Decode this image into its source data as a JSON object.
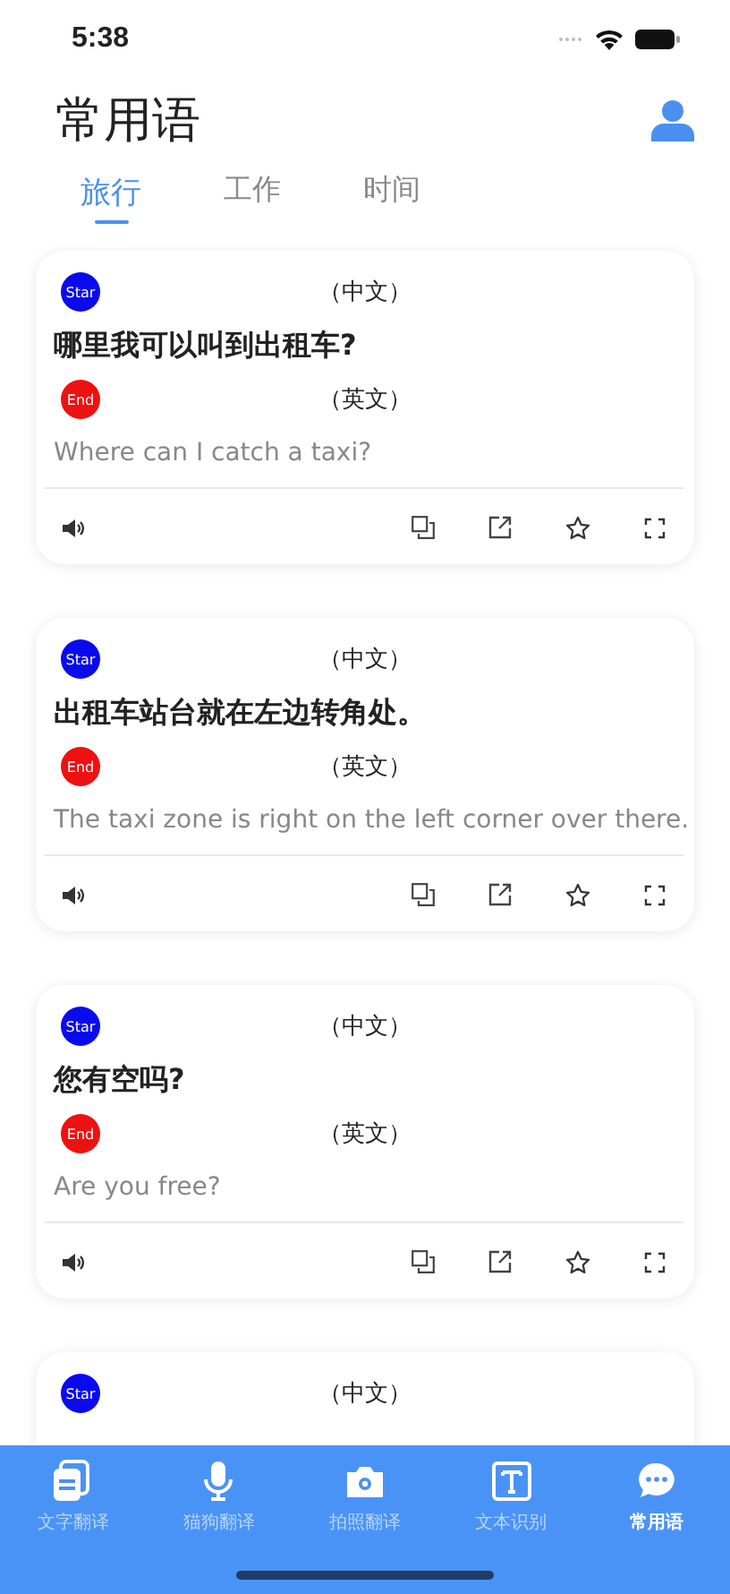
{
  "status_bar": {
    "time": "5:38"
  },
  "header": {
    "title": "常用语"
  },
  "tabs": [
    {
      "label": "旅行",
      "selected": true
    },
    {
      "label": "工作",
      "selected": false
    },
    {
      "label": "时间",
      "selected": false
    }
  ],
  "cards": [
    {
      "source_badge": "Star",
      "source_lang": "（中文）",
      "source_text": "哪里我可以叫到出租车?",
      "target_badge": "End",
      "target_lang": "（英文）",
      "target_text": "Where can I catch a taxi?"
    },
    {
      "source_badge": "Star",
      "source_lang": "（中文）",
      "source_text": "出租车站台就在左边转角处。",
      "target_badge": "End",
      "target_lang": "（英文）",
      "target_text": "The taxi zone is right on the left corner over there."
    },
    {
      "source_badge": "Star",
      "source_lang": "（中文）",
      "source_text": "您有空吗?",
      "target_badge": "End",
      "target_lang": "（英文）",
      "target_text": "Are you free?"
    },
    {
      "source_badge": "Star",
      "source_lang": "（中文）"
    }
  ],
  "bottom_nav": [
    {
      "label": "文字翻译",
      "selected": false
    },
    {
      "label": "猫狗翻译",
      "selected": false
    },
    {
      "label": "拍照翻译",
      "selected": false
    },
    {
      "label": "文本识别",
      "selected": false
    },
    {
      "label": "常用语",
      "selected": true
    }
  ]
}
